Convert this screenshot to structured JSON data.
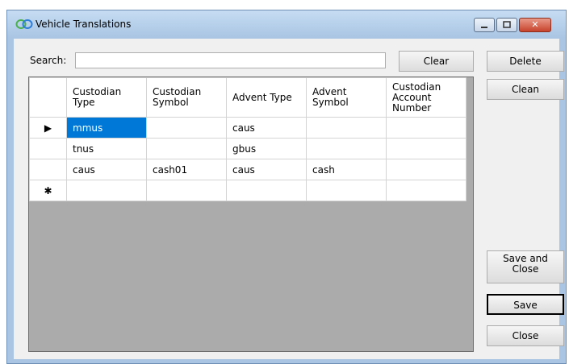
{
  "window": {
    "title": "Vehicle Translations",
    "close_glyph": "✕"
  },
  "search": {
    "label": "Search:",
    "value": ""
  },
  "buttons": {
    "clear": "Clear",
    "delete": "Delete",
    "clean": "Clean",
    "save_and_close_line1": "Save and",
    "save_and_close_line2": "Close",
    "save": "Save",
    "close": "Close"
  },
  "grid": {
    "columns": [
      "Custodian Type",
      "Custodian Symbol",
      "Advent Type",
      "Advent Symbol",
      "Custodian Account Number"
    ],
    "rows": [
      {
        "indicator": "▶",
        "cells": [
          "mmus",
          "",
          "caus",
          "",
          ""
        ]
      },
      {
        "indicator": "",
        "cells": [
          "tnus",
          "",
          "gbus",
          "",
          ""
        ]
      },
      {
        "indicator": "",
        "cells": [
          "caus",
          "cash01",
          "caus",
          "cash",
          ""
        ]
      },
      {
        "indicator": "✱",
        "cells": [
          "",
          "",
          "",
          "",
          ""
        ]
      }
    ]
  },
  "colors": {
    "selected_cell": "#0078d7",
    "grid_empty_area": "#ababab",
    "title_bar": "#a9c5e3"
  }
}
